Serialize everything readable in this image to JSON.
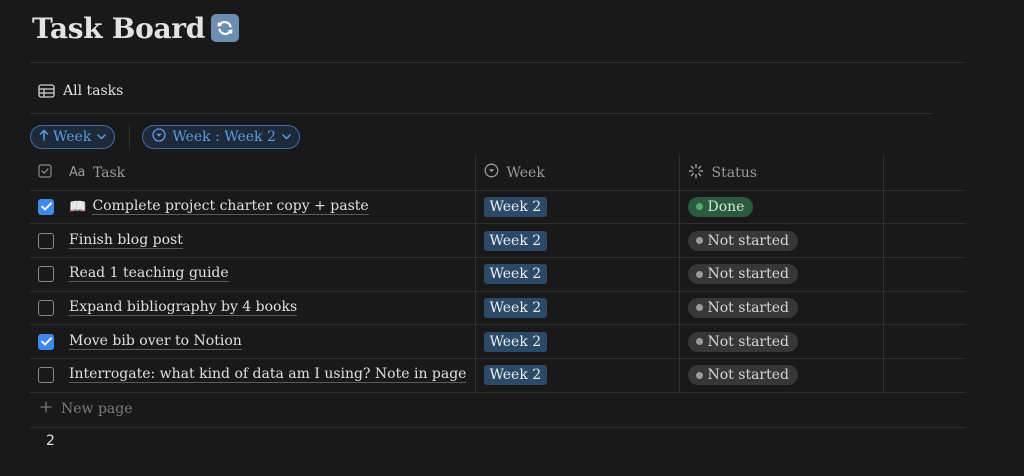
{
  "page": {
    "title": "Task Board"
  },
  "view": {
    "label": "All tasks"
  },
  "filters": {
    "sort_label": "Week",
    "filter_label": "Week : Week 2"
  },
  "table": {
    "columns": {
      "task": "Task",
      "week": "Week",
      "status": "Status"
    },
    "rows": [
      {
        "checked": true,
        "emoji": "📖",
        "task": "Complete project charter copy + paste",
        "week": "Week 2",
        "status": "Done"
      },
      {
        "checked": false,
        "emoji": "",
        "task": "Finish blog post",
        "week": "Week 2",
        "status": "Not started"
      },
      {
        "checked": false,
        "emoji": "",
        "task": "Read 1 teaching guide",
        "week": "Week 2",
        "status": "Not started"
      },
      {
        "checked": false,
        "emoji": "",
        "task": "Expand bibliography by 4 books",
        "week": "Week 2",
        "status": "Not started"
      },
      {
        "checked": true,
        "emoji": "",
        "task": "Move bib over to Notion",
        "week": "Week 2",
        "status": "Not started"
      },
      {
        "checked": false,
        "emoji": "",
        "task": "Interrogate: what kind of data am I using? Note in page",
        "week": "Week 2",
        "status": "Not started"
      }
    ],
    "new_page_label": "New page",
    "count": "2"
  },
  "icons": {
    "title_icon": "sync-icon",
    "view_icon": "table-icon",
    "sort_icon": "arrow-up-icon",
    "filter_icon": "select-icon",
    "week_col_icon": "select-icon",
    "status_col_icon": "loader-icon"
  },
  "colors": {
    "background": "#191919",
    "accent": "#3e88f0",
    "week_tag": "#2c4a67",
    "status_done_bg": "#2b5a3e",
    "status_done_dot": "#4fae6e",
    "status_notstarted_bg": "#373737",
    "status_notstarted_dot": "#9b9b9b"
  }
}
